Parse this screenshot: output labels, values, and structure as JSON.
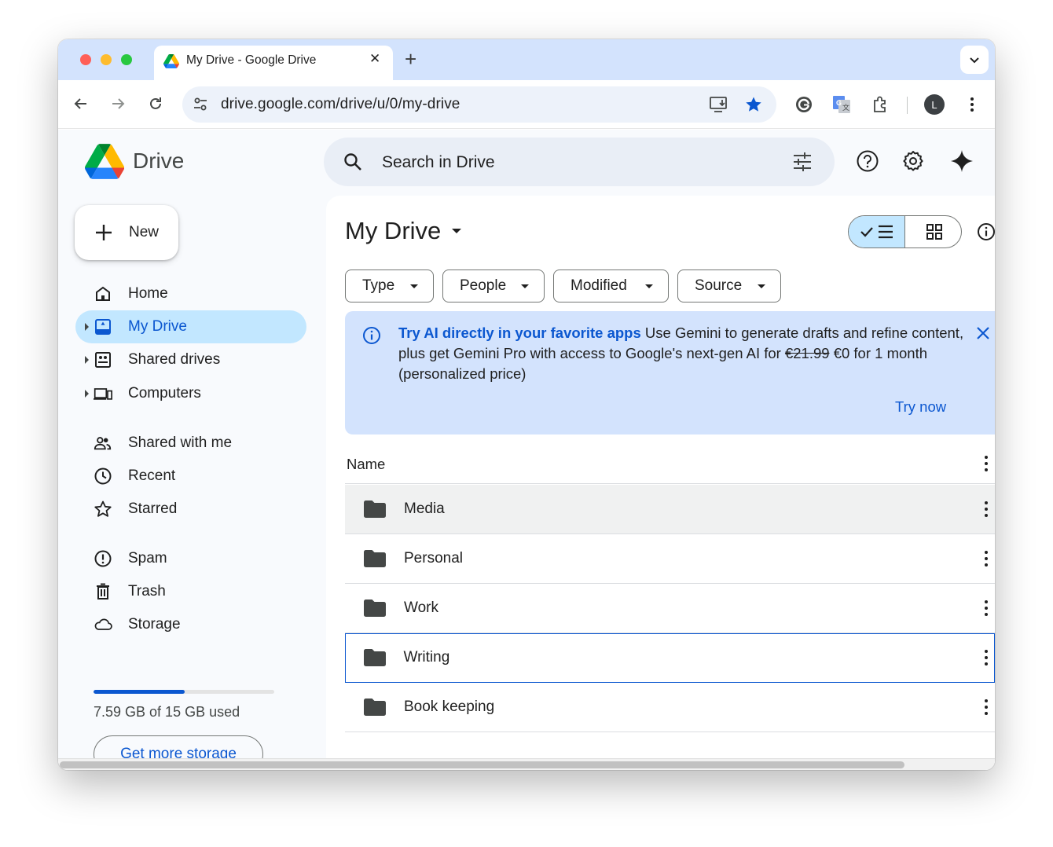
{
  "browser": {
    "tab_title": "My Drive - Google Drive",
    "tab_close": "✕",
    "new_tab": "+",
    "url": "drive.google.com/drive/u/0/my-drive",
    "avatar_letter": "L"
  },
  "app": {
    "logo_text": "Drive",
    "search_placeholder": "Search in Drive",
    "new_button": "New"
  },
  "sidebar": {
    "items": [
      {
        "label": "Home",
        "icon": "home-icon",
        "active": false,
        "caret": false
      },
      {
        "label": "My Drive",
        "icon": "my-drive-icon",
        "active": true,
        "caret": true
      },
      {
        "label": "Shared drives",
        "icon": "shared-drives-icon",
        "active": false,
        "caret": true
      },
      {
        "label": "Computers",
        "icon": "computers-icon",
        "active": false,
        "caret": true
      },
      {
        "label": "Shared with me",
        "icon": "people-icon",
        "active": false,
        "caret": false
      },
      {
        "label": "Recent",
        "icon": "clock-icon",
        "active": false,
        "caret": false
      },
      {
        "label": "Starred",
        "icon": "star-icon",
        "active": false,
        "caret": false
      },
      {
        "label": "Spam",
        "icon": "spam-icon",
        "active": false,
        "caret": false
      },
      {
        "label": "Trash",
        "icon": "trash-icon",
        "active": false,
        "caret": false
      },
      {
        "label": "Storage",
        "icon": "cloud-icon",
        "active": false,
        "caret": false
      }
    ],
    "storage_used_fraction": 0.506,
    "storage_text": "7.59 GB of 15 GB used",
    "get_more_storage": "Get more storage"
  },
  "main": {
    "title": "My Drive",
    "filters": [
      "Type",
      "People",
      "Modified",
      "Source"
    ],
    "banner": {
      "headline": "Try AI directly in your favorite apps",
      "body_before_price": " Use Gemini to generate drafts and refine content, plus get Gemini Pro with access to Google's next-gen AI for ",
      "old_price": "€21.99",
      "body_after_price": " €0 for 1 month (personalized price)",
      "cta": "Try now"
    },
    "column_name": "Name",
    "folders": [
      {
        "name": "Media",
        "state": "hover"
      },
      {
        "name": "Personal",
        "state": ""
      },
      {
        "name": "Work",
        "state": ""
      },
      {
        "name": "Writing",
        "state": "focused"
      },
      {
        "name": "Book keeping",
        "state": ""
      }
    ]
  },
  "colors": {
    "accent": "#0b57d0",
    "active_bg": "#c2e7ff",
    "banner_bg": "#d3e3fd",
    "tabstrip_bg": "#d3e3fd"
  }
}
